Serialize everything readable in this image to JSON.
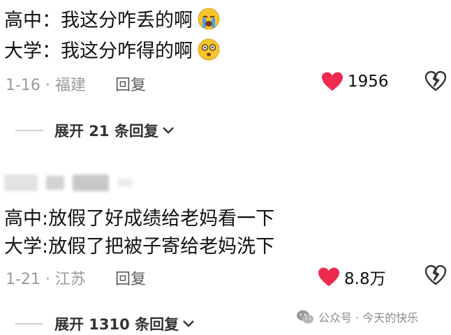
{
  "comment1": {
    "line1": "高中：我这分咋丢的啊",
    "line1_emoji": "crying-face",
    "line2": "大学：我这分咋得的啊",
    "line2_emoji": "dizzy-face",
    "meta": "1-16 · 福建",
    "reply_label": "回复",
    "likes": "1956",
    "expand_label": "展开 21 条回复"
  },
  "comment2": {
    "line1": "高中:放假了好成绩给老妈看一下",
    "line2": "大学:放假了把被子寄给老妈洗下",
    "meta": "1-21 · 江苏",
    "reply_label": "回复",
    "likes": "8.8万",
    "expand_label": "展开 1310 条回复"
  },
  "watermark": {
    "text": "公众号 · 今天的快乐"
  },
  "colors": {
    "like_red": "#ef2a50",
    "meta_gray": "#9a9a9a",
    "emoji_yellow": "#f6c52d",
    "tear_blue": "#4aa3e8"
  }
}
